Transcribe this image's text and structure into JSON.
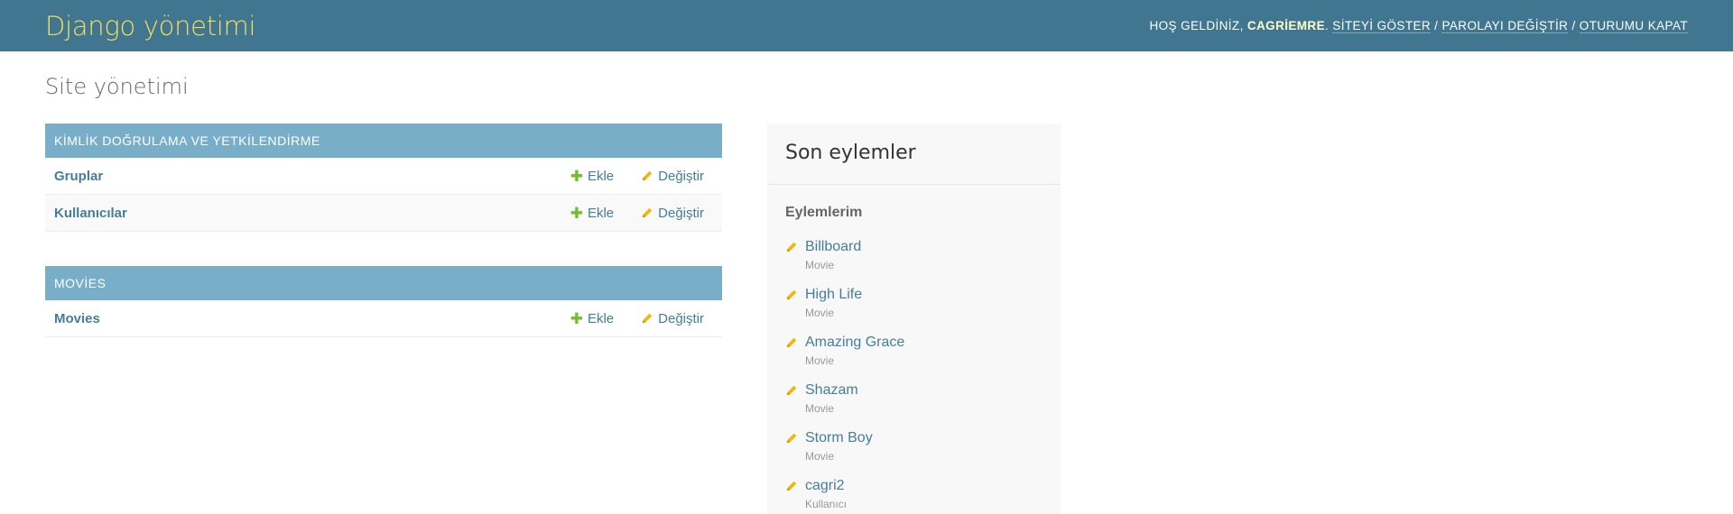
{
  "header": {
    "branding": "Django yönetimi",
    "welcome": "HOŞ GELDİNİZ,",
    "username": "CAGRİEMRE",
    "period": ".",
    "view_site": "SİTEYİ GÖSTER",
    "change_password": "PAROLAYI DEĞİŞTİR",
    "logout": "OTURUMU KAPAT",
    "separator": "/"
  },
  "page": {
    "title": "Site yönetimi"
  },
  "apps": [
    {
      "caption": "KİMLİK DOĞRULAMA VE YETKİLENDİRME",
      "models": [
        {
          "name": "Gruplar",
          "add": "Ekle",
          "change": "Değiştir"
        },
        {
          "name": "Kullanıcılar",
          "add": "Ekle",
          "change": "Değiştir"
        }
      ]
    },
    {
      "caption": "MOVİES",
      "models": [
        {
          "name": "Movies",
          "add": "Ekle",
          "change": "Değiştir"
        }
      ]
    }
  ],
  "recent_actions": {
    "title": "Son eylemler",
    "subtitle": "Eylemlerim",
    "items": [
      {
        "name": "Billboard",
        "type": "Movie"
      },
      {
        "name": "High Life",
        "type": "Movie"
      },
      {
        "name": "Amazing Grace",
        "type": "Movie"
      },
      {
        "name": "Shazam",
        "type": "Movie"
      },
      {
        "name": "Storm Boy",
        "type": "Movie"
      },
      {
        "name": "cagri2",
        "type": "Kullanıcı"
      }
    ]
  },
  "colors": {
    "header_bg": "#417690",
    "branding": "#f5dd5d",
    "caption_bg": "#79aec8",
    "link": "#447e9b",
    "add_icon": "#70bf2b",
    "change_icon": "#efb80b"
  },
  "icons": {
    "add": "plus-icon",
    "change": "pencil-icon"
  }
}
